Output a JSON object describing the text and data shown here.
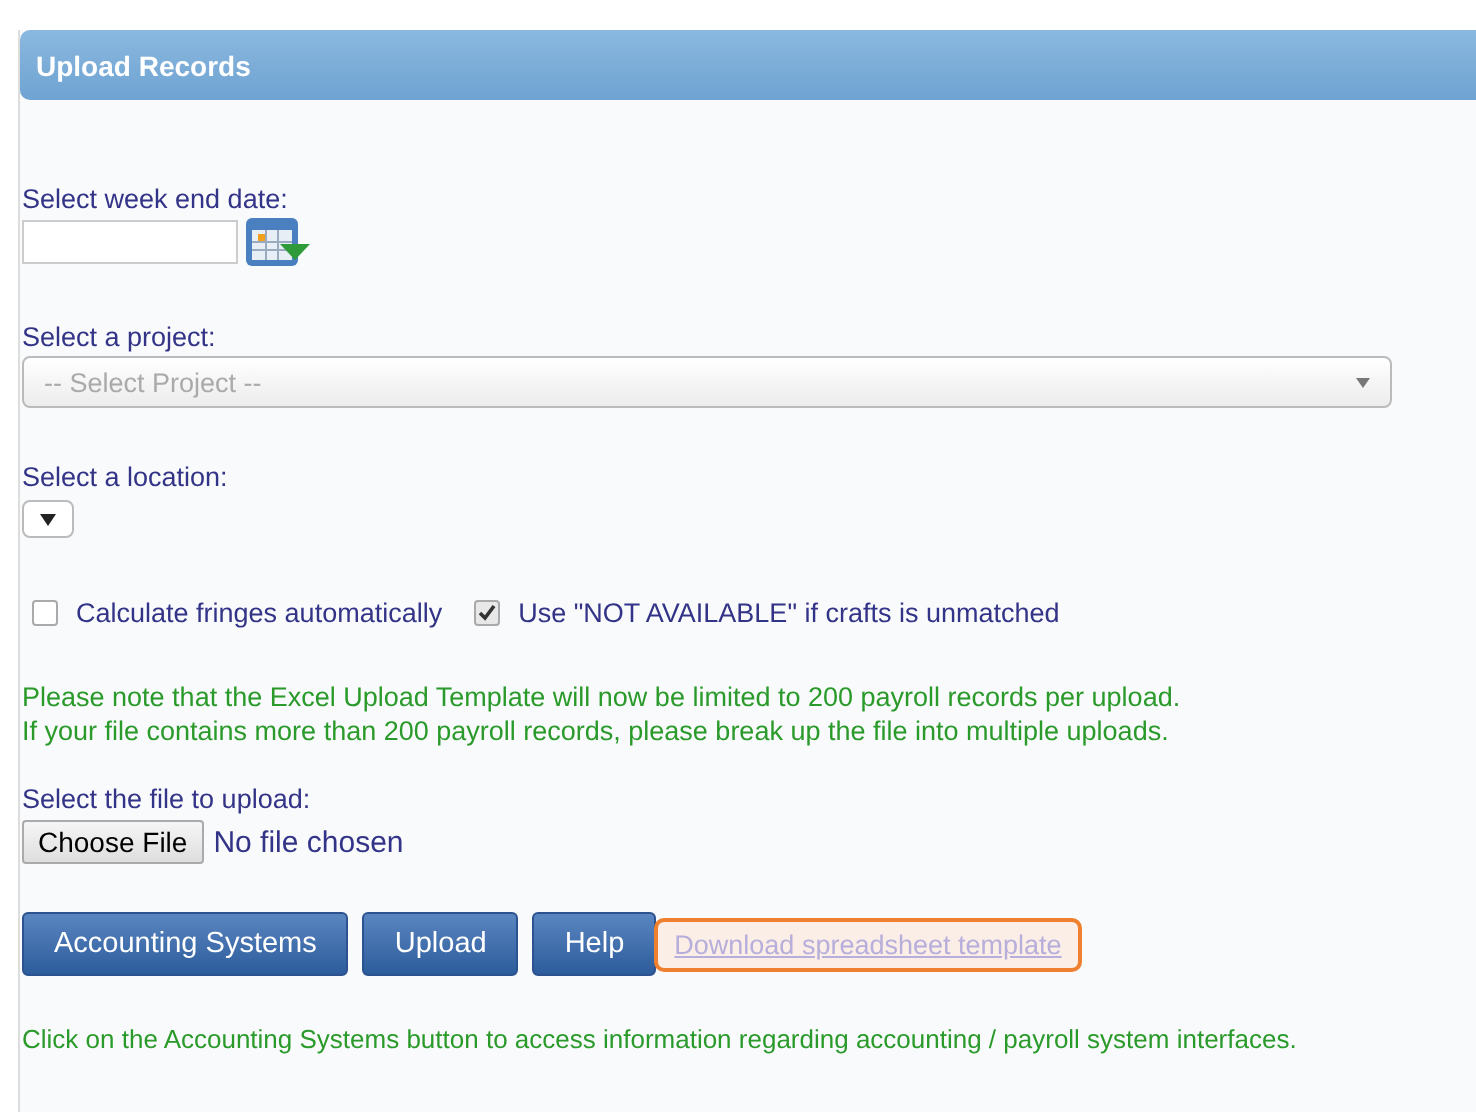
{
  "panel": {
    "title": "Upload Records"
  },
  "week_end": {
    "label": "Select week end date:"
  },
  "project": {
    "label": "Select a project:",
    "placeholder": "-- Select Project --"
  },
  "location": {
    "label": "Select a location:"
  },
  "options": [
    {
      "label": "Calculate fringes automatically",
      "checked": false
    },
    {
      "label": "Use \"NOT AVAILABLE\" if crafts is unmatched",
      "checked": true
    }
  ],
  "notes": [
    "Please note that the Excel Upload Template will now be limited to 200 payroll records per upload.",
    "If your file contains more than 200 payroll records, please break up the file into multiple uploads."
  ],
  "file": {
    "label": "Select the file to upload:",
    "button": "Choose File",
    "status": "No file chosen"
  },
  "buttons": [
    "Accounting Systems",
    "Upload",
    "Help"
  ],
  "template_link": {
    "label": "Download spreadsheet template",
    "highlighted": true
  },
  "footer_note": "Click on the Accounting Systems button to access information regarding accounting / payroll system interfaces."
}
